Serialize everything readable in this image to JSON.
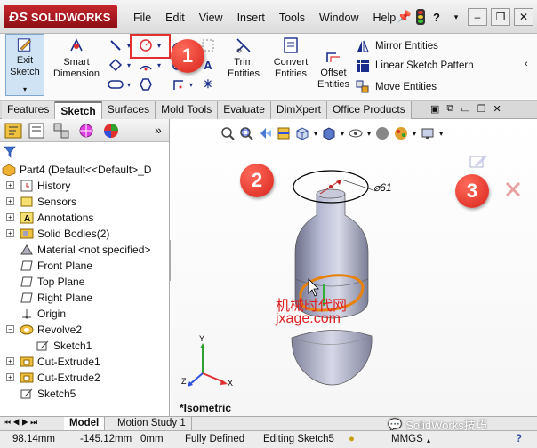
{
  "app": {
    "logo": "SOLIDWORKS",
    "menu": [
      "File",
      "Edit",
      "View",
      "Insert",
      "Tools",
      "Window",
      "Help"
    ],
    "help_glyph": "?"
  },
  "command_manager": {
    "exit_sketch": "Exit Sketch",
    "smart_dimension": "Smart Dimension",
    "trim_entities": "Trim Entities",
    "convert_entities": "Convert Entities",
    "offset_entities": "Offset Entities",
    "mirror_entities": "Mirror Entities",
    "linear_sketch_pattern": "Linear Sketch Pattern",
    "move_entities": "Move Entities"
  },
  "tabs": [
    "Features",
    "Sketch",
    "Surfaces",
    "Mold Tools",
    "Evaluate",
    "DimXpert",
    "Office Products"
  ],
  "active_tab": "Sketch",
  "feature_tree": {
    "part": "Part4  (Default<<Default>_D",
    "items": [
      {
        "label": "History",
        "icon": "history-icon",
        "expandable": true
      },
      {
        "label": "Sensors",
        "icon": "sensors-icon",
        "expandable": true
      },
      {
        "label": "Annotations",
        "icon": "annotations-icon",
        "expandable": true
      },
      {
        "label": "Solid Bodies(2)",
        "icon": "solid-bodies-icon",
        "expandable": true
      },
      {
        "label": "Material <not specified>",
        "icon": "material-icon",
        "expandable": false
      },
      {
        "label": "Front Plane",
        "icon": "plane-icon",
        "expandable": false
      },
      {
        "label": "Top Plane",
        "icon": "plane-icon",
        "expandable": false
      },
      {
        "label": "Right Plane",
        "icon": "plane-icon",
        "expandable": false
      },
      {
        "label": "Origin",
        "icon": "origin-icon",
        "expandable": false
      },
      {
        "label": "Revolve2",
        "icon": "revolve-icon",
        "expandable": true
      },
      {
        "label": "Sketch1",
        "icon": "sketch-icon",
        "expandable": false
      },
      {
        "label": "Cut-Extrude1",
        "icon": "cut-extrude-icon",
        "expandable": true
      },
      {
        "label": "Cut-Extrude2",
        "icon": "cut-extrude-icon",
        "expandable": true
      },
      {
        "label": "Sketch5",
        "icon": "sketch-icon",
        "expandable": false
      }
    ]
  },
  "graphics": {
    "dimension": "⌀61",
    "view_label": "*Isometric",
    "watermark_cn": "机械时代网",
    "watermark_url": "jxage.com"
  },
  "callouts": [
    "1",
    "2",
    "3"
  ],
  "bottom_tabs": [
    "Model",
    "Motion Study 1"
  ],
  "status": {
    "x": "98.14mm",
    "y": "-145.12mm",
    "z": "0mm",
    "state": "Fully Defined",
    "editing": "Editing Sketch5",
    "units": "MMGS"
  },
  "wechat_watermark": "SolidWorks技巧",
  "colors": {
    "brand_red": "#c6262e",
    "sketch_blue": "#1a2d8a",
    "callout_red": "#d8241c",
    "highlight_orange": "#e8820c"
  }
}
